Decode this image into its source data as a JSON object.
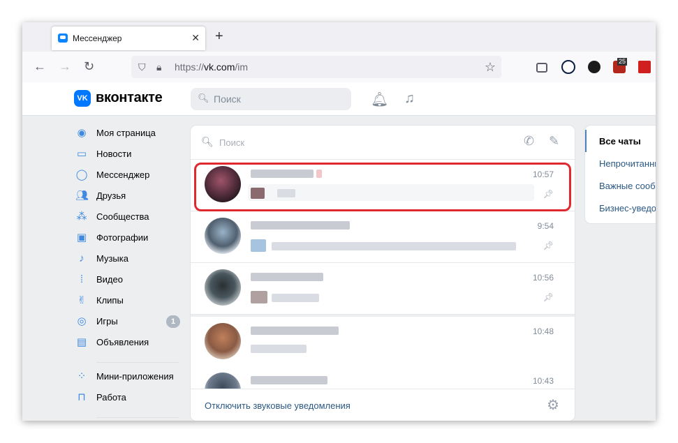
{
  "browser": {
    "tab_title": "Мессенджер",
    "tab_close": "✕",
    "new_tab": "+",
    "url_prefix": "https://",
    "url_host": "vk.com",
    "url_path": "/im",
    "extension_badge": "25"
  },
  "vk": {
    "logo_text": "VK",
    "brand_name": "вконтакте",
    "search_placeholder": "Поиск"
  },
  "sidebar": {
    "items": [
      {
        "label": "Моя страница",
        "icon": "user-circle-icon"
      },
      {
        "label": "Новости",
        "icon": "news-icon"
      },
      {
        "label": "Мессенджер",
        "icon": "message-icon"
      },
      {
        "label": "Друзья",
        "icon": "friends-icon"
      },
      {
        "label": "Сообщества",
        "icon": "communities-icon"
      },
      {
        "label": "Фотографии",
        "icon": "photo-icon"
      },
      {
        "label": "Музыка",
        "icon": "music-icon"
      },
      {
        "label": "Видео",
        "icon": "video-icon"
      },
      {
        "label": "Клипы",
        "icon": "clips-icon"
      },
      {
        "label": "Игры",
        "icon": "games-icon",
        "badge": "1"
      },
      {
        "label": "Объявления",
        "icon": "ads-icon"
      },
      {
        "label": "Мини-приложения",
        "icon": "apps-icon"
      },
      {
        "label": "Работа",
        "icon": "work-icon"
      }
    ]
  },
  "chats": {
    "search_placeholder": "Поиск",
    "conversations": [
      {
        "time": "10:57",
        "pinned": true
      },
      {
        "time": "9:54",
        "pinned": true
      },
      {
        "time": "10:56",
        "pinned": true
      },
      {
        "time": "10:48",
        "pinned": false
      },
      {
        "time": "10:43",
        "pinned": false
      }
    ],
    "footer_link": "Отключить звуковые уведомления"
  },
  "filters": {
    "items": [
      {
        "label": "Все чаты",
        "active": true
      },
      {
        "label": "Непрочитанные",
        "active": false
      },
      {
        "label": "Важные сообщения",
        "active": false
      },
      {
        "label": "Бизнес-уведомления",
        "active": false
      }
    ]
  },
  "colors": {
    "accent": "#0077ff",
    "link": "#2a5885",
    "highlight": "#e0282e"
  }
}
